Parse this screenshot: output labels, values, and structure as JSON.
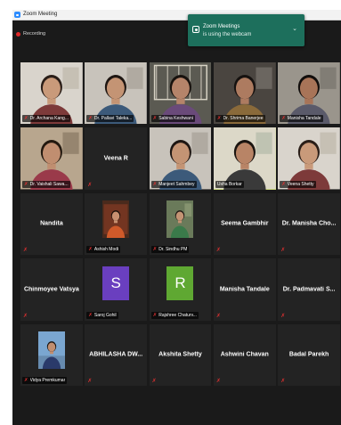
{
  "window": {
    "title": "Zoom Meeting",
    "recording_label": "Recording"
  },
  "notification": {
    "title": "Zoom Meetings",
    "body": "is using the webcam",
    "icon": "webcam-icon",
    "background": "#1d6f5c"
  },
  "colors": {
    "mute": "#e03030",
    "active_speaker_border": "#c8e05a",
    "tile_background": "#232323"
  },
  "participants": [
    {
      "kind": "video",
      "name": "Dr. Archana Kang...",
      "muted": true,
      "scene": "wall-light"
    },
    {
      "kind": "video",
      "name": "Dr. Pallavi Taleka...",
      "muted": true,
      "scene": "room-soft"
    },
    {
      "kind": "video",
      "name": "Sabina Keshwani",
      "muted": true,
      "scene": "window-bars"
    },
    {
      "kind": "video",
      "name": "Dr. Shrima Banerjee",
      "muted": true,
      "scene": "room-dark"
    },
    {
      "kind": "video",
      "name": "Manisha Tandale",
      "muted": true,
      "scene": "wall-grey"
    },
    {
      "kind": "video",
      "name": "Dr. Vaishali Sawa...",
      "muted": true,
      "scene": "room-warm"
    },
    {
      "kind": "name",
      "name": "Veena R",
      "muted": true
    },
    {
      "kind": "video",
      "name": "Manjeet Sahmbey",
      "muted": true,
      "scene": "room-soft"
    },
    {
      "kind": "video",
      "name": "Usha Borkar",
      "muted": false,
      "active": true,
      "scene": "room-bright"
    },
    {
      "kind": "video",
      "name": "Veena Shetty",
      "muted": true,
      "scene": "wall-light"
    },
    {
      "kind": "name",
      "name": "Nandita",
      "muted": true
    },
    {
      "kind": "photo",
      "name": "Ashish Modi",
      "muted": true,
      "scene": "photo-red"
    },
    {
      "kind": "photo",
      "name": "Dr. Sindhu PM",
      "muted": true,
      "scene": "photo-green"
    },
    {
      "kind": "name",
      "name": "Seema Gambhir",
      "muted": true
    },
    {
      "kind": "name",
      "name": "Dr. Manisha Cho...",
      "muted": true
    },
    {
      "kind": "name",
      "name": "Chinmoyee Vatsya",
      "muted": true
    },
    {
      "kind": "avatar",
      "name": "Saroj Gohil",
      "initial": "S",
      "color": "#6a3fbf",
      "muted": true
    },
    {
      "kind": "avatar",
      "name": "Rajshree Chaturv...",
      "initial": "R",
      "color": "#5fa832",
      "muted": true
    },
    {
      "kind": "name",
      "name": "Manisha Tandale",
      "muted": true
    },
    {
      "kind": "name",
      "name": "Dr. Padmavati S...",
      "muted": true
    },
    {
      "kind": "photo",
      "name": "Vidya Premkumar",
      "muted": true,
      "scene": "photo-sky"
    },
    {
      "kind": "name",
      "name": "ABHILASHA DW...",
      "muted": true
    },
    {
      "kind": "name",
      "name": "Akshita Shetty",
      "muted": true
    },
    {
      "kind": "name",
      "name": "Ashwini Chavan",
      "muted": true
    },
    {
      "kind": "name",
      "name": "Badal Parekh",
      "muted": true
    }
  ]
}
